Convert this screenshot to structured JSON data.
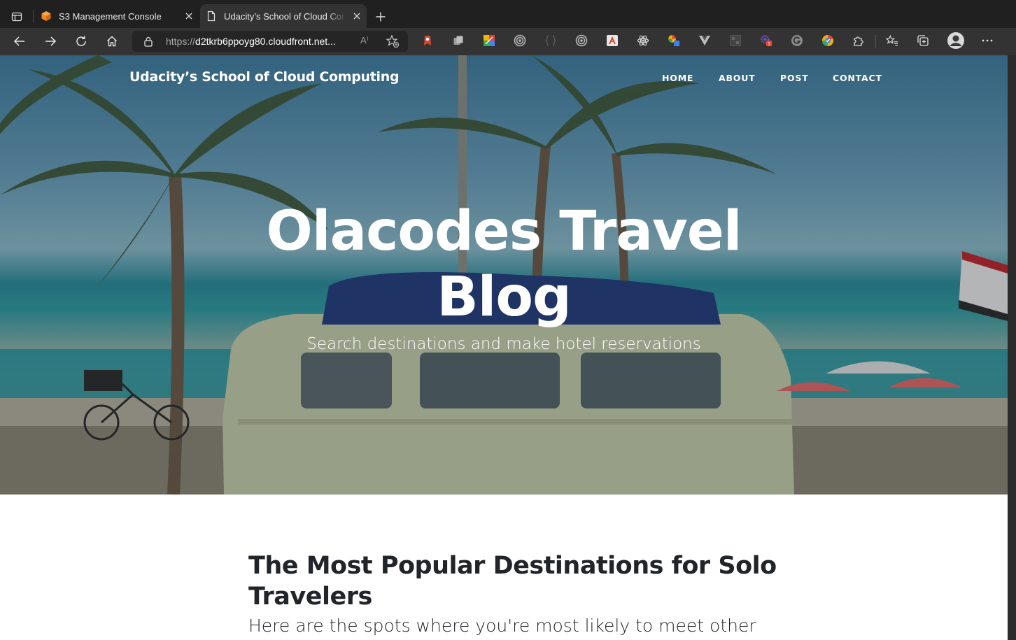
{
  "browser": {
    "tabs": [
      {
        "title": "S3 Management Console",
        "icon": "aws-cube-icon",
        "active": false
      },
      {
        "title": "Udacity’s School of Cloud Computing",
        "icon": "page-icon",
        "active": true
      }
    ],
    "address": {
      "scheme": "https://",
      "host": "d2tkrb6ppoyg80.cloudfront.net...",
      "read_aloud": "A⁾"
    },
    "extensions": [
      "bookmark-extension-icon",
      "copy-extension-icon",
      "color-grid-extension-icon",
      "target-extension-icon",
      "json-braces-extension-icon",
      "target-extension-icon-2",
      "lambda-extension-icon",
      "react-extension-icon",
      "colorzilla-extension-icon",
      "vue-extension-icon",
      "box-extension-icon",
      "gear-badge-extension-icon",
      "grammarly-extension-icon",
      "chrome-check-extension-icon",
      "puzzle-extensions-icon"
    ],
    "extension_badge": "1",
    "colors": {
      "tab_strip": "#202020",
      "toolbar": "#333333",
      "omnibox": "#252525"
    }
  },
  "site": {
    "brand": "Udacity’s School of Cloud Computing",
    "nav": [
      "HOME",
      "ABOUT",
      "POST",
      "CONTACT"
    ],
    "hero_title_line1": "Olacodes Travel",
    "hero_title_line2": "Blog",
    "hero_subtitle": "Search destinations and make hotel reservations",
    "post_title": "The Most Popular Destinations for Solo Travelers",
    "post_teaser": "Here are the spots where you're most likely to meet other"
  }
}
